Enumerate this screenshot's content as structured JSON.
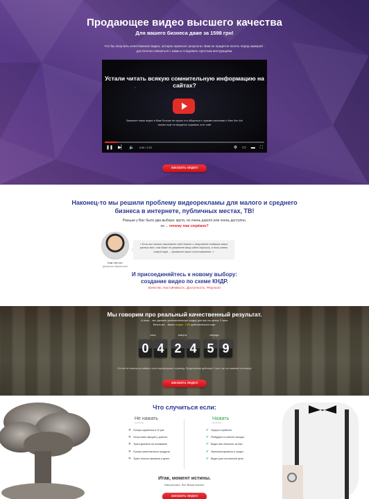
{
  "hero": {
    "title": "Продающее видео высшего качества",
    "subtitle": "Для вашего бизнеса даже за 1598 грн!",
    "description": "Что бы получить качественное видео, которое принесет результат. Вам не придется потеть перед камерой - достаточно связаться с нами и следовать простым инструкциям.",
    "video": {
      "headline": "Устали читать всякую сомнительную информацию на сайтах?",
      "caption": "Закажите наше видео и Вам больше не нужно что общаться с чужими каналами и Ким Чен Ын сказал ещё не придется скрывать этот сайт",
      "time": "0:00 / 1:23",
      "progress": 0.08
    },
    "cta": "заказать видео"
  },
  "problem": {
    "title": "Наконец-то мы решили проблему видеорекламы для малого и среднего бизнеса в интернете, публичных местах, ТВ!",
    "text_line1": "Раньше у Вас было два выбора: круто, но очень дорого или очень доступно,",
    "text_line2_prefix": "но ...",
    "text_line2_red": "почему так стрёмно?",
    "person_name": "Ким Чен Ын",
    "person_role": "Директор энергетикой",
    "quote": "« Если вы только начинаете свой бизнес и получаете создание каких разных мне, так даже не уважаете вашу идею хороших, а если имело такой изум ... проявите наше сопоставление. »",
    "join_title_1": "И присоединяйтесь к новому выбору:",
    "join_title_2": "создание видео по схеме КНДР.",
    "join_sub": "Качество. Настойчивость. Доступность. Результат"
  },
  "results": {
    "title": "Мы говорим про реальный качественный результат.",
    "desc_line1": "А done... мы сделали дополнительную скидку для вас на целых 3 часа.",
    "desc_prefix": "Вечно же... Ваша",
    "desc_yellow": "скидка -10%",
    "desc_suffix": "действительна еще:",
    "timer_labels": [
      "часы",
      "минуты",
      "секунды"
    ],
    "digits": [
      "0",
      "4",
      "2",
      "4",
      "5",
      "9"
    ],
    "note": "Отстой не наносится займом, если перезагрузить страницу. Предложение действует 1 раз, так что нажмите на кнопку!",
    "cta": "заказать видео"
  },
  "what": {
    "title": "Что случиться если:",
    "left_head": "Не нажать",
    "left_sub": "на кнопку",
    "left_items": [
      "Потеря заработка в 10 раз",
      "Отсутствие эмоций у зрителя",
      "Трата времени на понимание",
      "Потеря качественного продукта",
      "Трата личного времени и денег"
    ],
    "right_head": "Нажать",
    "right_sub": "на кнопку",
    "right_items": [
      "Прирост прибыли",
      "Разбудите в клиенте эмоции",
      "Видео всё объяснит за Вас",
      "Экономия времени и средст",
      "Видео для постоянной цели"
    ],
    "final_title": "Итак, момент истины.",
    "final_sub": "Вам решать. Вот Ваша кнопка:",
    "cta": "заказать видео"
  }
}
